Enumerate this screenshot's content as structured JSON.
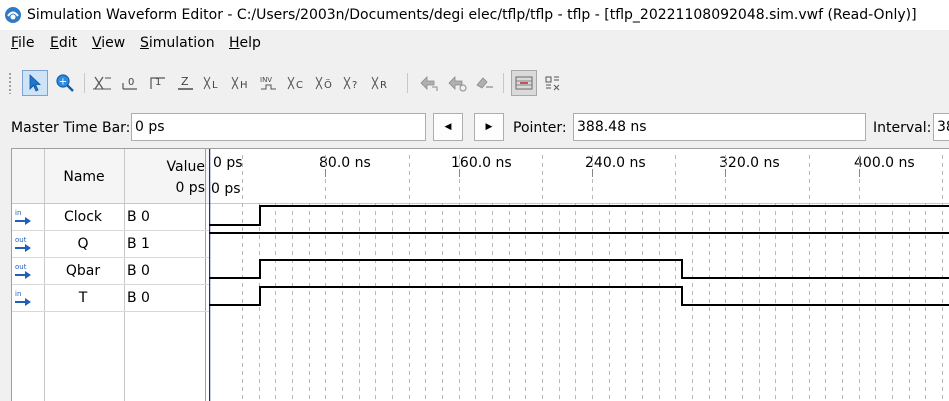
{
  "window": {
    "title": "Simulation Waveform Editor - C:/Users/2003n/Documents/degi elec/tflp/tflp - tflp - [tflp_20221108092048.sim.vwf (Read-Only)]"
  },
  "menu": [
    {
      "first": "F",
      "rest": "ile"
    },
    {
      "first": "E",
      "rest": "dit"
    },
    {
      "first": "V",
      "rest": "iew"
    },
    {
      "first": "S",
      "rest": "imulation"
    },
    {
      "first": "H",
      "rest": "elp"
    }
  ],
  "toolbar": {
    "buttons": [
      "selection-tool-icon",
      "zoom-tool-icon",
      "uninitialized-x-icon",
      "forcing-low-icon",
      "forcing-high-icon",
      "high-impedance-icon",
      "invert-icon",
      "count-value-icon",
      "clock-icon",
      "weak-low-icon",
      "weak-high-icon",
      "dont-care-icon",
      "random-value-icon",
      "arbitrary-value-icon",
      "run-functional-simulation-icon",
      "run-timing-simulation-icon",
      "generate-netlist-icon",
      "snap-to-grid-icon",
      "grid-settings-icon"
    ]
  },
  "timebar": {
    "master_label": "Master Time Bar:",
    "master_value": "0 ps",
    "pointer_label": "Pointer:",
    "pointer_value": "388.48 ns",
    "interval_label": "Interval:",
    "interval_value": "38"
  },
  "grid": {
    "name_header": "Name",
    "value_header": "Value",
    "value_time": "0 ps",
    "cursor_time": "0 ps",
    "ticks": [
      "0 ps",
      "80.0 ns",
      "160.0 ns",
      "240.0 ns",
      "320.0 ns",
      "400.0 ns"
    ]
  },
  "signals": [
    {
      "dir": "in",
      "name": "Clock",
      "value": "B 0"
    },
    {
      "dir": "out",
      "name": "Q",
      "value": "B 1"
    },
    {
      "dir": "out",
      "name": "Qbar",
      "value": "B 0"
    },
    {
      "dir": "in",
      "name": "T",
      "value": "B 0"
    }
  ],
  "colors": {
    "waveform": "#000000",
    "cursor": "#1f2fa0",
    "grid_dash": "#b8b8b8",
    "selection": "#cde3f7"
  }
}
